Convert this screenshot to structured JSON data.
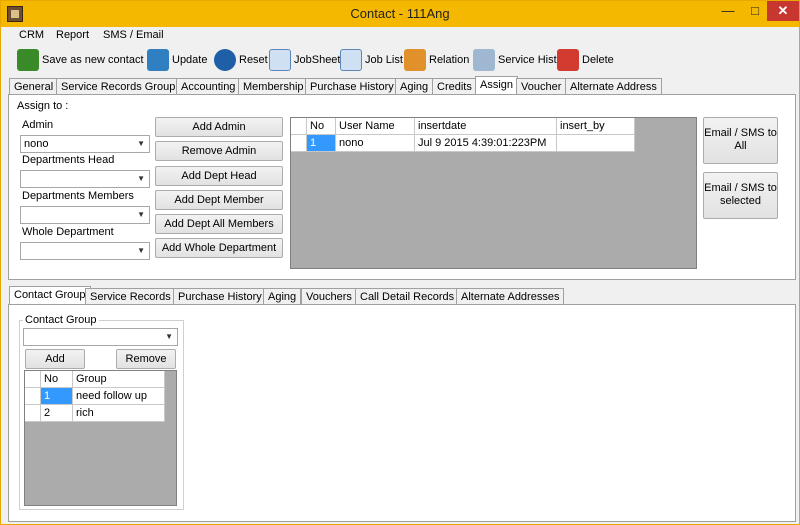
{
  "window": {
    "title": "Contact - 111Ang",
    "min": "—",
    "max": "□",
    "close": "✕"
  },
  "menu": [
    "CRM",
    "Report",
    "SMS / Email"
  ],
  "toolbar": [
    {
      "label": "Save as new contact",
      "icon": "add-user-icon"
    },
    {
      "label": "Update",
      "icon": "update-icon"
    },
    {
      "label": "Reset",
      "icon": "reset-icon"
    },
    {
      "label": "JobSheet",
      "icon": "jobsheet-icon"
    },
    {
      "label": "Job List",
      "icon": "job-list-icon"
    },
    {
      "label": "Relation",
      "icon": "relation-icon"
    },
    {
      "label": "Service Hist.",
      "icon": "service-history-icon"
    },
    {
      "label": "Delete",
      "icon": "delete-user-icon"
    }
  ],
  "top_tabs": [
    "General",
    "Service Records Group",
    "Accounting",
    "Membership",
    "Purchase History",
    "Aging",
    "Credits",
    "Assign",
    "Voucher",
    "Alternate Address"
  ],
  "assign": {
    "group_title": "Assign to :",
    "admin_label": "Admin",
    "admin_value": "nono",
    "dept_head_label": "Departments Head",
    "dept_head_value": "",
    "dept_members_label": "Departments Members",
    "dept_members_value": "",
    "whole_dept_label": "Whole Department",
    "whole_dept_value": "",
    "buttons": [
      "Add Admin",
      "Remove Admin",
      "Add Dept Head",
      "Add Dept Member",
      "Add Dept All Members",
      "Add Whole Department"
    ],
    "grid_headers": [
      "No",
      "User Name",
      "insertdate",
      "insert_by"
    ],
    "grid_rows": [
      {
        "no": "1",
        "user": "nono",
        "date": "Jul  9 2015  4:39:01:223PM",
        "by": ""
      }
    ],
    "email_all": "Email / SMS to All",
    "email_selected": "Email / SMS to selected"
  },
  "bottom_tabs": [
    "Contact Group",
    "Service Records",
    "Purchase History",
    "Aging",
    "Vouchers",
    "Call Detail Records",
    "Alternate Addresses"
  ],
  "contact_group": {
    "title": "Contact Group",
    "value": "",
    "add_label": "Add",
    "remove_label": "Remove",
    "grid_headers": [
      "No",
      "Group"
    ],
    "grid_rows": [
      {
        "no": "1",
        "group": "need follow up"
      },
      {
        "no": "2",
        "group": "rich"
      }
    ]
  }
}
